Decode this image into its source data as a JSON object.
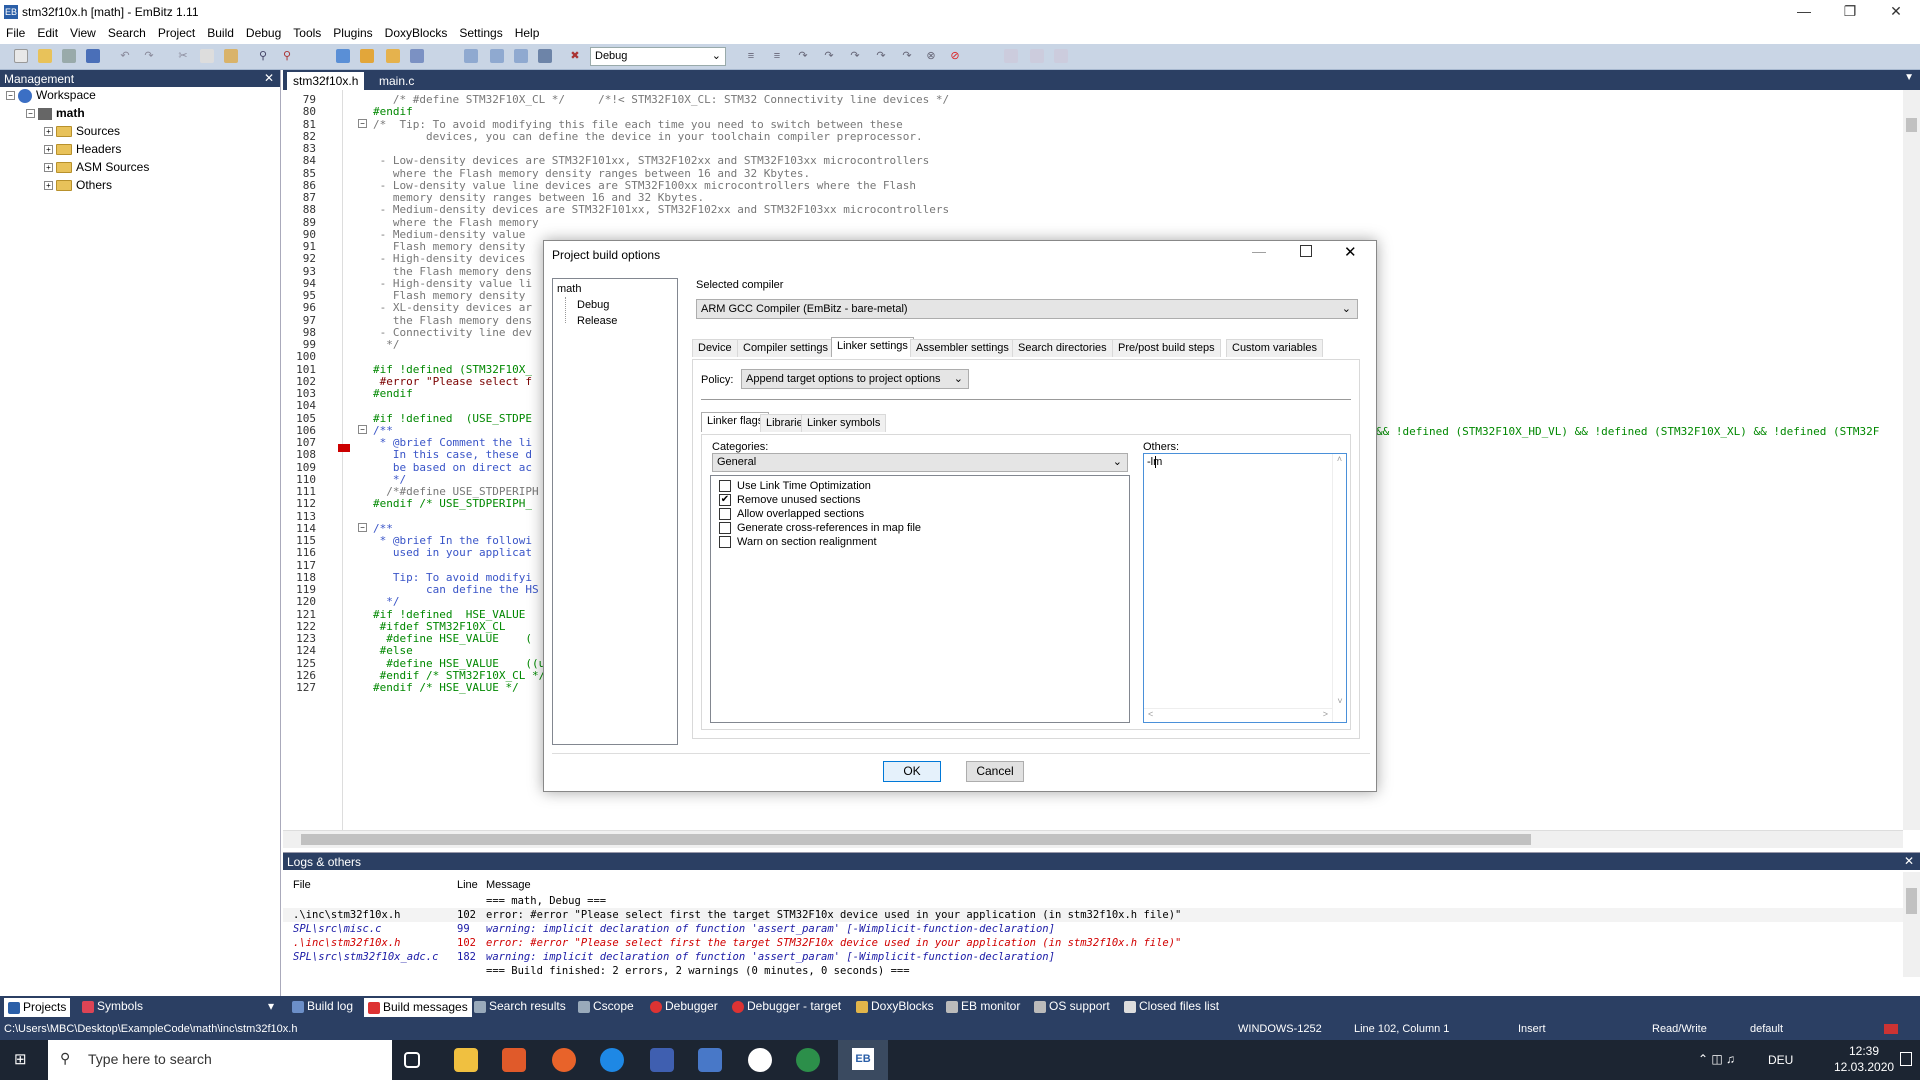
{
  "window": {
    "title": "stm32f10x.h [math] - EmBitz 1.11"
  },
  "menu": [
    "File",
    "Edit",
    "View",
    "Search",
    "Project",
    "Build",
    "Debug",
    "Tools",
    "Plugins",
    "DoxyBlocks",
    "Settings",
    "Help"
  ],
  "toolbar": {
    "build_target": "Debug"
  },
  "management": {
    "title": "Management",
    "workspace": "Workspace",
    "project": "math",
    "folders": [
      "Sources",
      "Headers",
      "ASM Sources",
      "Others"
    ]
  },
  "editor": {
    "tabs": [
      "stm32f10x.h",
      "main.c"
    ],
    "line_numbers": [
      "79",
      "80",
      "81",
      "82",
      "83",
      "84",
      "85",
      "86",
      "87",
      "88",
      "89",
      "90",
      "91",
      "92",
      "93",
      "94",
      "95",
      "96",
      "97",
      "98",
      "99",
      "100",
      "101",
      "102",
      "103",
      "104",
      "105",
      "106",
      "107",
      "108",
      "109",
      "110",
      "111",
      "112",
      "113",
      "114",
      "115",
      "116",
      "117",
      "118",
      "119",
      "120",
      "121",
      "122",
      "123",
      "124",
      "125",
      "126",
      "127"
    ],
    "lines": [
      {
        "t": "   /* #define STM32F10X_CL */     /*!< STM32F10X_CL: STM32 Connectivity line devices */",
        "c": "c-cmt"
      },
      {
        "t": "#endif",
        "c": "c-grn"
      },
      {
        "t": "/*  Tip: To avoid modifying this file each time you need to switch between these",
        "c": "c-cmt"
      },
      {
        "t": "        devices, you can define the device in your toolchain compiler preprocessor.",
        "c": "c-cmt"
      },
      {
        "t": "",
        "c": "c-cmt"
      },
      {
        "t": " - Low-density devices are STM32F101xx, STM32F102xx and STM32F103xx microcontrollers",
        "c": "c-cmt"
      },
      {
        "t": "   where the Flash memory density ranges between 16 and 32 Kbytes.",
        "c": "c-cmt"
      },
      {
        "t": " - Low-density value line devices are STM32F100xx microcontrollers where the Flash",
        "c": "c-cmt"
      },
      {
        "t": "   memory density ranges between 16 and 32 Kbytes.",
        "c": "c-cmt"
      },
      {
        "t": " - Medium-density devices are STM32F101xx, STM32F102xx and STM32F103xx microcontrollers",
        "c": "c-cmt"
      },
      {
        "t": "   where the Flash memory",
        "c": "c-cmt"
      },
      {
        "t": " - Medium-density value",
        "c": "c-cmt"
      },
      {
        "t": "   Flash memory density",
        "c": "c-cmt"
      },
      {
        "t": " - High-density devices",
        "c": "c-cmt"
      },
      {
        "t": "   the Flash memory dens",
        "c": "c-cmt"
      },
      {
        "t": " - High-density value li",
        "c": "c-cmt"
      },
      {
        "t": "   Flash memory density",
        "c": "c-cmt"
      },
      {
        "t": " - XL-density devices ar",
        "c": "c-cmt"
      },
      {
        "t": "   the Flash memory dens",
        "c": "c-cmt"
      },
      {
        "t": " - Connectivity line dev",
        "c": "c-cmt"
      },
      {
        "t": "  */",
        "c": "c-cmt"
      },
      {
        "t": "",
        "c": "c-cmt"
      },
      {
        "t": "#if !defined (STM32F10X_",
        "c": "c-grn"
      },
      {
        "t": " #error \"Please select f",
        "c": "c-red"
      },
      {
        "t": "#endif",
        "c": "c-grn"
      },
      {
        "t": "",
        "c": "c-cmt"
      },
      {
        "t": "#if !defined  (USE_STDPE",
        "c": "c-grn"
      },
      {
        "t": "/**",
        "c": "c-blu"
      },
      {
        "t": " * @brief Comment the li",
        "c": "c-blu"
      },
      {
        "t": "   In this case, these d",
        "c": "c-blu"
      },
      {
        "t": "   be based on direct ac",
        "c": "c-blu"
      },
      {
        "t": "   */",
        "c": "c-blu"
      },
      {
        "t": "  /*#define USE_STDPERIPH",
        "c": "c-cmt"
      },
      {
        "t": "#endif /* USE_STDPERIPH_",
        "c": "c-grn"
      },
      {
        "t": "",
        "c": "c-cmt"
      },
      {
        "t": "/**",
        "c": "c-blu"
      },
      {
        "t": " * @brief In the followi",
        "c": "c-blu"
      },
      {
        "t": "   used in your applicat",
        "c": "c-blu"
      },
      {
        "t": "",
        "c": "c-cmt"
      },
      {
        "t": "   Tip: To avoid modifyi",
        "c": "c-blu"
      },
      {
        "t": "        can define the HS",
        "c": "c-blu"
      },
      {
        "t": "  */",
        "c": "c-blu"
      },
      {
        "t": "#if !defined  HSE_VALUE",
        "c": "c-grn"
      },
      {
        "t": " #ifdef STM32F10X_CL",
        "c": "c-grn"
      },
      {
        "t": "  #define HSE_VALUE    (",
        "c": "c-grn"
      },
      {
        "t": " #else",
        "c": "c-grn"
      },
      {
        "t": "  #define HSE_VALUE    ((uint32_t)8000000) /*!< Value of the External oscillator in Hz */",
        "c": "c-grn"
      },
      {
        "t": " #endif /* STM32F10X_CL */",
        "c": "c-grn"
      },
      {
        "t": "#endif /* HSE_VALUE */",
        "c": "c-grn"
      }
    ],
    "line_101_tail": "&& !defined (STM32F10X_HD_VL) && !defined (STM32F10X_XL) && !defined (STM32F"
  },
  "logs": {
    "title": "Logs & others",
    "columns": [
      "File",
      "Line",
      "Message"
    ],
    "rows": [
      {
        "file": "",
        "line": "",
        "msg": "=== math, Debug ===",
        "kind": "info"
      },
      {
        "file": ".\\inc\\stm32f10x.h",
        "line": "102",
        "msg": "error: #error \"Please select first the target STM32F10x device used in your application (in stm32f10x.h file)\"",
        "kind": "plain"
      },
      {
        "file": "SPL\\src\\misc.c",
        "line": "99",
        "msg": "warning: implicit declaration of function 'assert_param' [-Wimplicit-function-declaration]",
        "kind": "warn"
      },
      {
        "file": ".\\inc\\stm32f10x.h",
        "line": "102",
        "msg": "error: #error \"Please select first the target STM32F10x device used in your application (in stm32f10x.h file)\"",
        "kind": "err"
      },
      {
        "file": "SPL\\src\\stm32f10x_adc.c",
        "line": "182",
        "msg": "warning: implicit declaration of function 'assert_param' [-Wimplicit-function-declaration]",
        "kind": "warn"
      },
      {
        "file": "",
        "line": "",
        "msg": "=== Build finished: 2 errors, 2 warnings (0 minutes, 0 seconds) ===",
        "kind": "info"
      }
    ]
  },
  "bottom_tabs": {
    "left": [
      "Projects",
      "Symbols"
    ],
    "right": [
      "Build log",
      "Build messages",
      "Search results",
      "Cscope",
      "Debugger",
      "Debugger - target",
      "DoxyBlocks",
      "EB monitor",
      "OS support",
      "Closed files list"
    ]
  },
  "status": {
    "path": "C:\\Users\\MBC\\Desktop\\ExampleCode\\math\\inc\\stm32f10x.h",
    "encoding": "WINDOWS-1252",
    "position": "Line 102, Column 1",
    "mode": "Insert",
    "access": "Read/Write",
    "profile": "default"
  },
  "taskbar": {
    "search_placeholder": "Type here to search",
    "lang": "DEU",
    "time": "12:39",
    "date": "12.03.2020"
  },
  "dialog": {
    "title": "Project build options",
    "targets": [
      "math",
      "Debug",
      "Release"
    ],
    "selected_compiler_label": "Selected compiler",
    "compiler": "ARM GCC Compiler (EmBitz - bare-metal)",
    "tabs": [
      "Device",
      "Compiler settings",
      "Linker settings",
      "Assembler settings",
      "Search directories",
      "Pre/post build steps",
      "Custom variables"
    ],
    "policy_label": "Policy:",
    "policy": "Append target options to project options",
    "sub_tabs": [
      "Linker flags",
      "Libraries",
      "Linker symbols"
    ],
    "categories_label": "Categories:",
    "category": "General",
    "others_label": "Others:",
    "others_value": "-lm",
    "options": [
      {
        "label": "Use Link Time Optimization",
        "checked": false
      },
      {
        "label": "Remove unused sections",
        "checked": true
      },
      {
        "label": "Allow overlapped sections",
        "checked": false
      },
      {
        "label": "Generate cross-references in map file",
        "checked": false
      },
      {
        "label": "Warn on section realignment",
        "checked": false
      }
    ],
    "ok": "OK",
    "cancel": "Cancel"
  }
}
